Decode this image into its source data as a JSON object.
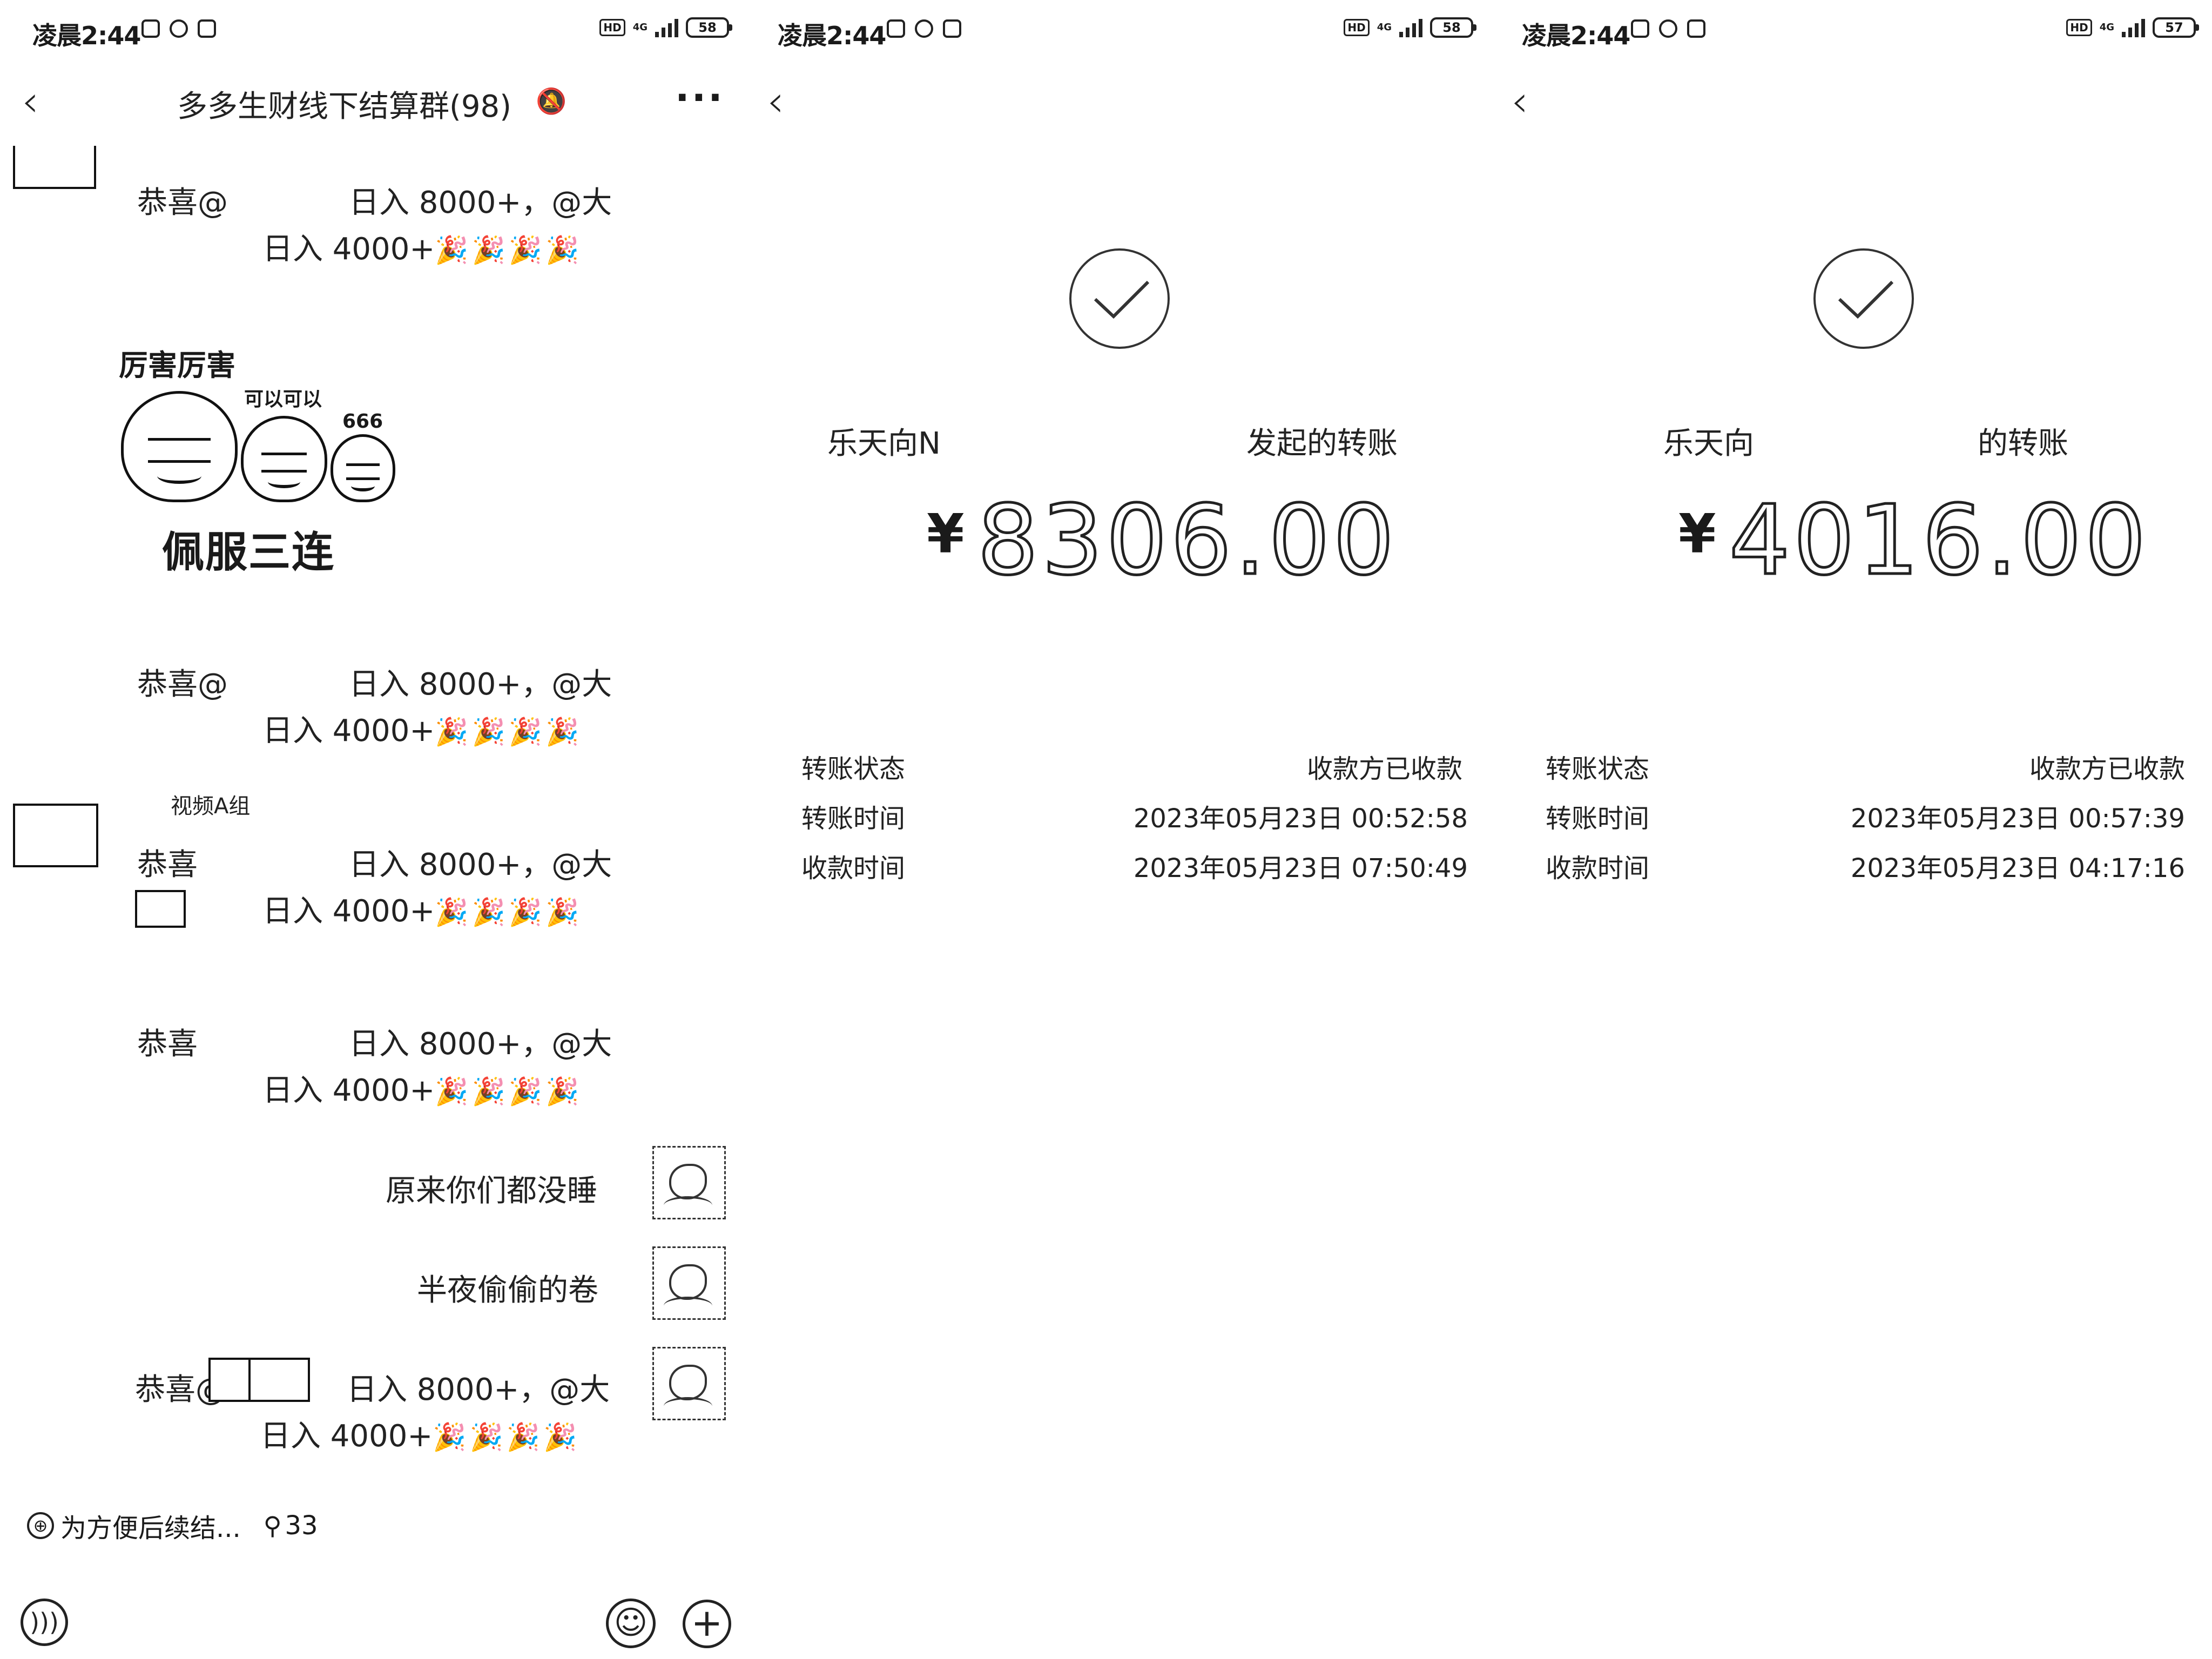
{
  "status_bars": [
    {
      "time": "凌晨2:44",
      "network": "4G",
      "battery": "58"
    },
    {
      "time": "凌晨2:44",
      "network": "4G",
      "battery": "58"
    },
    {
      "time": "凌晨2:44",
      "network": "4G",
      "battery": "57"
    }
  ],
  "chat": {
    "title": "多多生财线下结算群(98)",
    "messages": [
      {
        "line1_left": "恭喜@",
        "line1_right": "日入 8000+，@大",
        "line2_right": "日入 4000+"
      },
      {
        "line1_left": "恭喜@",
        "line1_right": "日入 8000+，@大",
        "line2_right": "日入 4000+"
      },
      {
        "line1_left": "恭喜",
        "line1_right": "日入 8000+，@大",
        "line2_right": "日入 4000+"
      },
      {
        "line1_left": "恭喜",
        "line1_right": "日入 8000+，@大",
        "line2_right": "日入 4000+"
      },
      {
        "line1_left": "恭喜@",
        "line1_right": "日入 8000+，@大",
        "line2_right": "日入 4000+"
      }
    ],
    "party_emoji": "🎉🎉🎉🎉",
    "meme": {
      "title": "厉害厉害",
      "subtitle": "可以可以",
      "number": "666",
      "bottom": "佩服三连"
    },
    "sender_label": "视频A组",
    "self_messages": [
      "原来你们都没睡",
      "半夜偷偷的卷"
    ],
    "notice": "为方便后续结...",
    "member_count": "33"
  },
  "transfers": [
    {
      "from_left": "乐天向N",
      "from_right": "发起的转账",
      "currency": "¥",
      "amount": "8306.00",
      "status_label": "转账状态",
      "status_value": "收款方已收款",
      "transfer_time_label": "转账时间",
      "transfer_time": "2023年05月23日 00:52:58",
      "receive_time_label": "收款时间",
      "receive_time": "2023年05月23日 07:50:49"
    },
    {
      "from_left": "乐天向",
      "from_right": "的转账",
      "currency": "¥",
      "amount": "4016.00",
      "status_label": "转账状态",
      "status_value": "收款方已收款",
      "transfer_time_label": "转账时间",
      "transfer_time": "2023年05月23日 00:57:39",
      "receive_time_label": "收款时间",
      "receive_time": "2023年05月23日 04:17:16"
    }
  ]
}
